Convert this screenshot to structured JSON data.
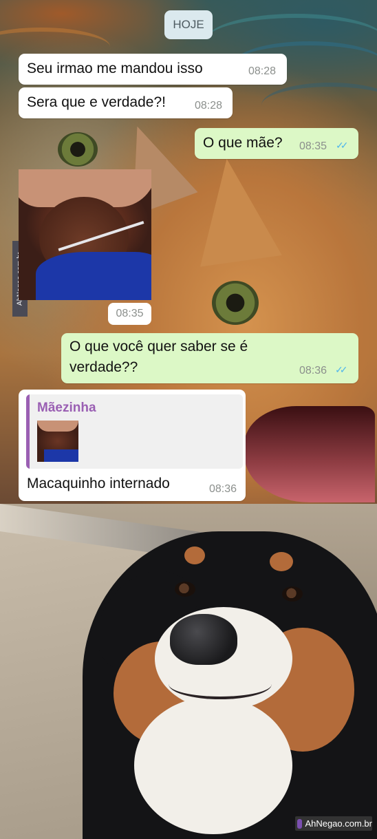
{
  "chat": {
    "date_chip": "HOJE",
    "messages": [
      {
        "direction": "in",
        "text": "Seu irmao me  mandou isso",
        "time": "08:28"
      },
      {
        "direction": "in",
        "text": "Sera que e verdade?!",
        "time": "08:28"
      },
      {
        "direction": "out",
        "text": "O que mãe?",
        "time": "08:35",
        "status": "read"
      },
      {
        "direction": "in",
        "type": "image",
        "time": "08:35"
      },
      {
        "direction": "out",
        "text_line1": "O que você quer saber se é",
        "text_line2": "verdade??",
        "time": "08:36",
        "status": "read"
      },
      {
        "direction": "in",
        "reply_to_name": "Mãezinha",
        "text": "Macaquinho internado",
        "time": "08:36"
      }
    ],
    "read_tick_glyph": "✓✓"
  },
  "watermarks": {
    "side": "AhNegao.com.br",
    "bottom": "AhNegao.com.br"
  },
  "colors": {
    "incoming_bubble": "#ffffff",
    "outgoing_bubble": "#dcf8c6",
    "read_ticks": "#4fb6ec",
    "reply_accent": "#9a5fb3"
  }
}
